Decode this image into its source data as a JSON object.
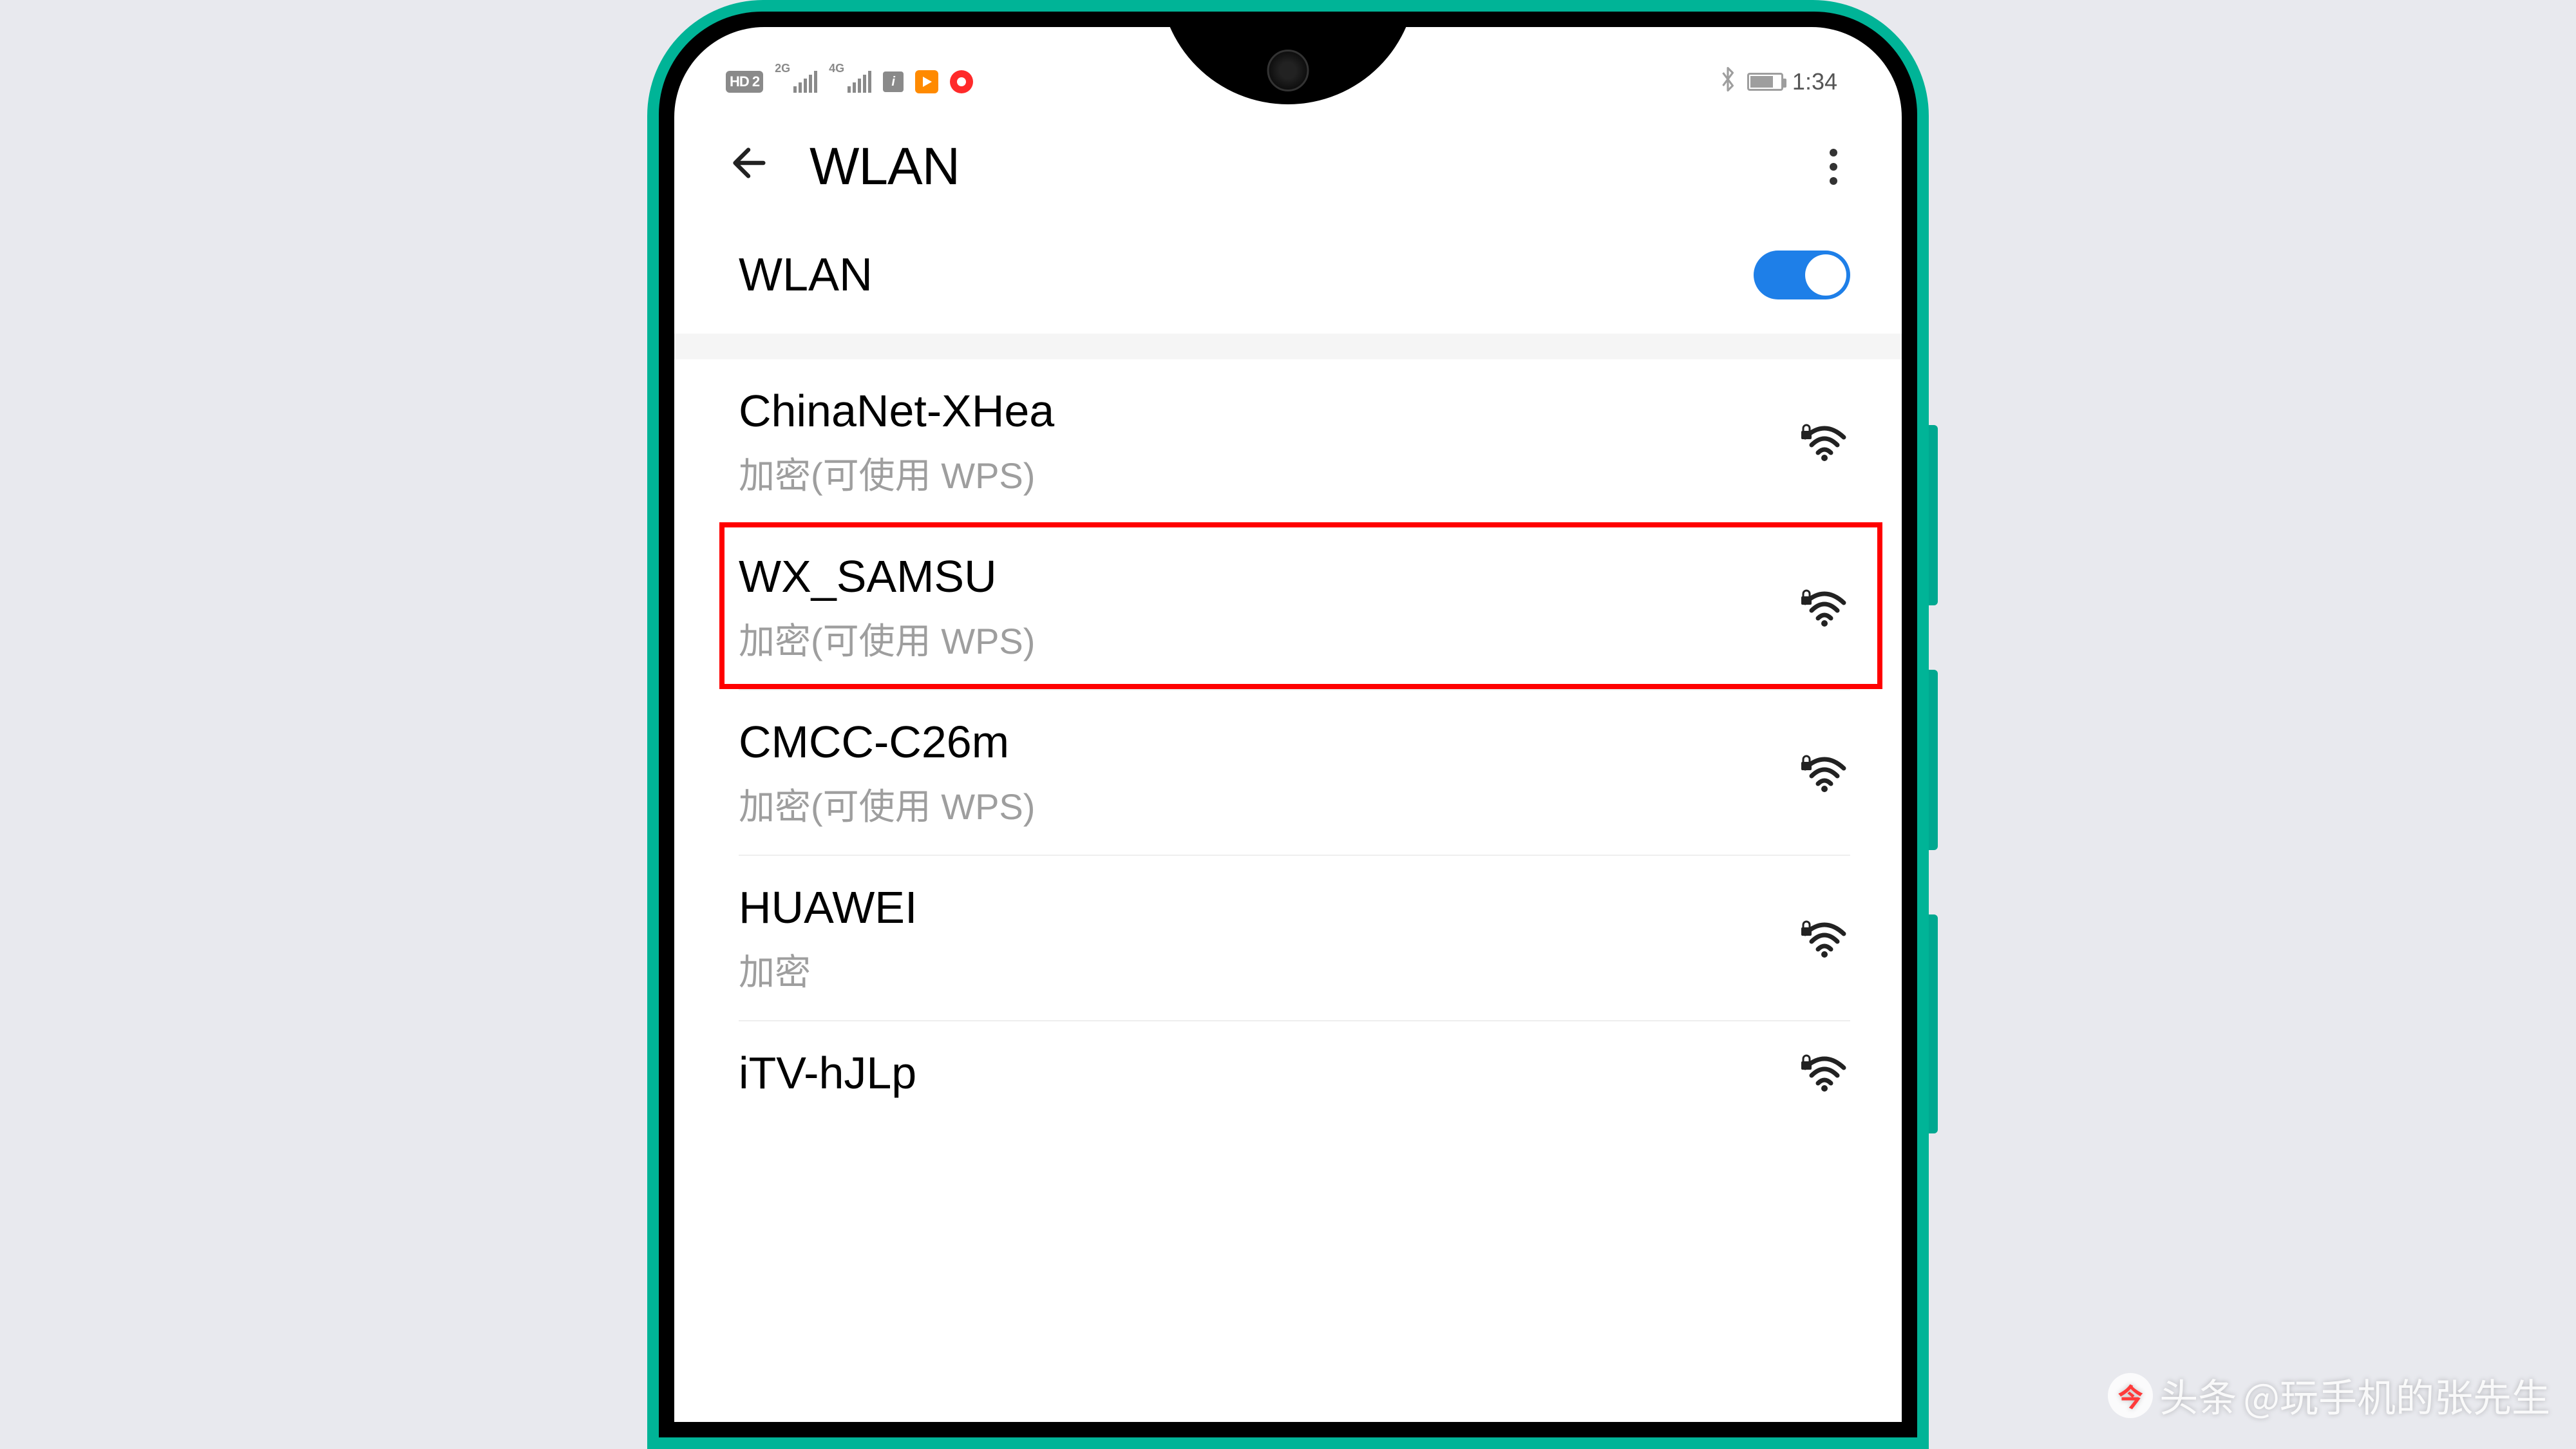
{
  "status_bar": {
    "hd_label": "HD 2",
    "signal1_label": "2G",
    "signal2_label": "4G",
    "time": "1:34"
  },
  "header": {
    "title": "WLAN"
  },
  "wlan_toggle": {
    "label": "WLAN",
    "enabled": true
  },
  "networks": [
    {
      "name": "ChinaNet-XHea",
      "detail": "加密(可使用 WPS)",
      "locked": true,
      "highlighted": false
    },
    {
      "name": "WX_SAMSU",
      "detail": "加密(可使用 WPS)",
      "locked": true,
      "highlighted": true
    },
    {
      "name": "CMCC-C26m",
      "detail": "加密(可使用 WPS)",
      "locked": true,
      "highlighted": false
    },
    {
      "name": "HUAWEI",
      "detail": "加密",
      "locked": true,
      "highlighted": false
    },
    {
      "name": "iTV-hJLp",
      "detail": "",
      "locked": true,
      "highlighted": false
    }
  ],
  "watermark": {
    "prefix": "头条",
    "handle": "@玩手机的张先生"
  }
}
